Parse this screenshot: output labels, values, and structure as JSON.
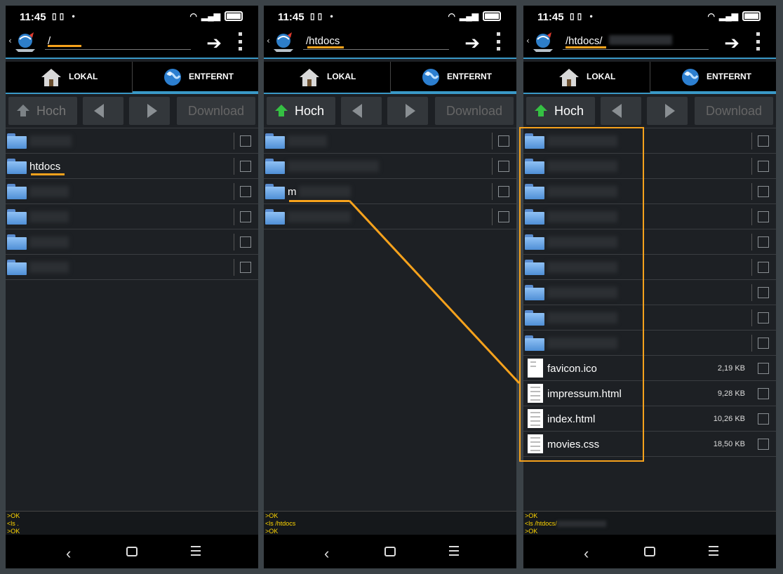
{
  "status": {
    "time": "11:45",
    "indicator": "▯▯ •"
  },
  "tabs": {
    "local": "LOKAL",
    "remote": "ENTFERNT"
  },
  "toolbar": {
    "up": "Hoch",
    "download": "Download"
  },
  "panels": [
    {
      "path": "/",
      "rows": [
        {
          "type": "folder",
          "name": ""
        },
        {
          "type": "folder",
          "name": "htdocs"
        },
        {
          "type": "folder",
          "name": ""
        },
        {
          "type": "folder",
          "name": ""
        },
        {
          "type": "folder",
          "name": ""
        },
        {
          "type": "folder",
          "name": ""
        }
      ],
      "log": [
        ">OK",
        "<ls .",
        ">OK"
      ]
    },
    {
      "path": "/htdocs",
      "rows": [
        {
          "type": "folder",
          "name": ""
        },
        {
          "type": "folder",
          "name": ""
        },
        {
          "type": "folder",
          "name": "m"
        },
        {
          "type": "folder",
          "name": ""
        }
      ],
      "log": [
        ">OK",
        "<ls /htdocs",
        ">OK"
      ]
    },
    {
      "path": "/htdocs/",
      "rows": [
        {
          "type": "folder",
          "name": ""
        },
        {
          "type": "folder",
          "name": ""
        },
        {
          "type": "folder",
          "name": ""
        },
        {
          "type": "folder",
          "name": ""
        },
        {
          "type": "folder",
          "name": ""
        },
        {
          "type": "folder",
          "name": ""
        },
        {
          "type": "folder",
          "name": ""
        },
        {
          "type": "folder",
          "name": ""
        },
        {
          "type": "folder",
          "name": ""
        },
        {
          "type": "file",
          "name": "favicon.ico",
          "size": "2,19 KB"
        },
        {
          "type": "file",
          "name": "impressum.html",
          "size": "9,28 KB"
        },
        {
          "type": "file",
          "name": "index.html",
          "size": "10,26 KB"
        },
        {
          "type": "file",
          "name": "movies.css",
          "size": "18,50 KB"
        }
      ],
      "log": [
        ">OK",
        "<ls /htdocs/",
        ">OK"
      ]
    }
  ],
  "colors": {
    "accent": "#3a99c7",
    "highlight": "#f6a21c",
    "log_text": "#ffd600",
    "up_arrow_active": "#35c043"
  }
}
